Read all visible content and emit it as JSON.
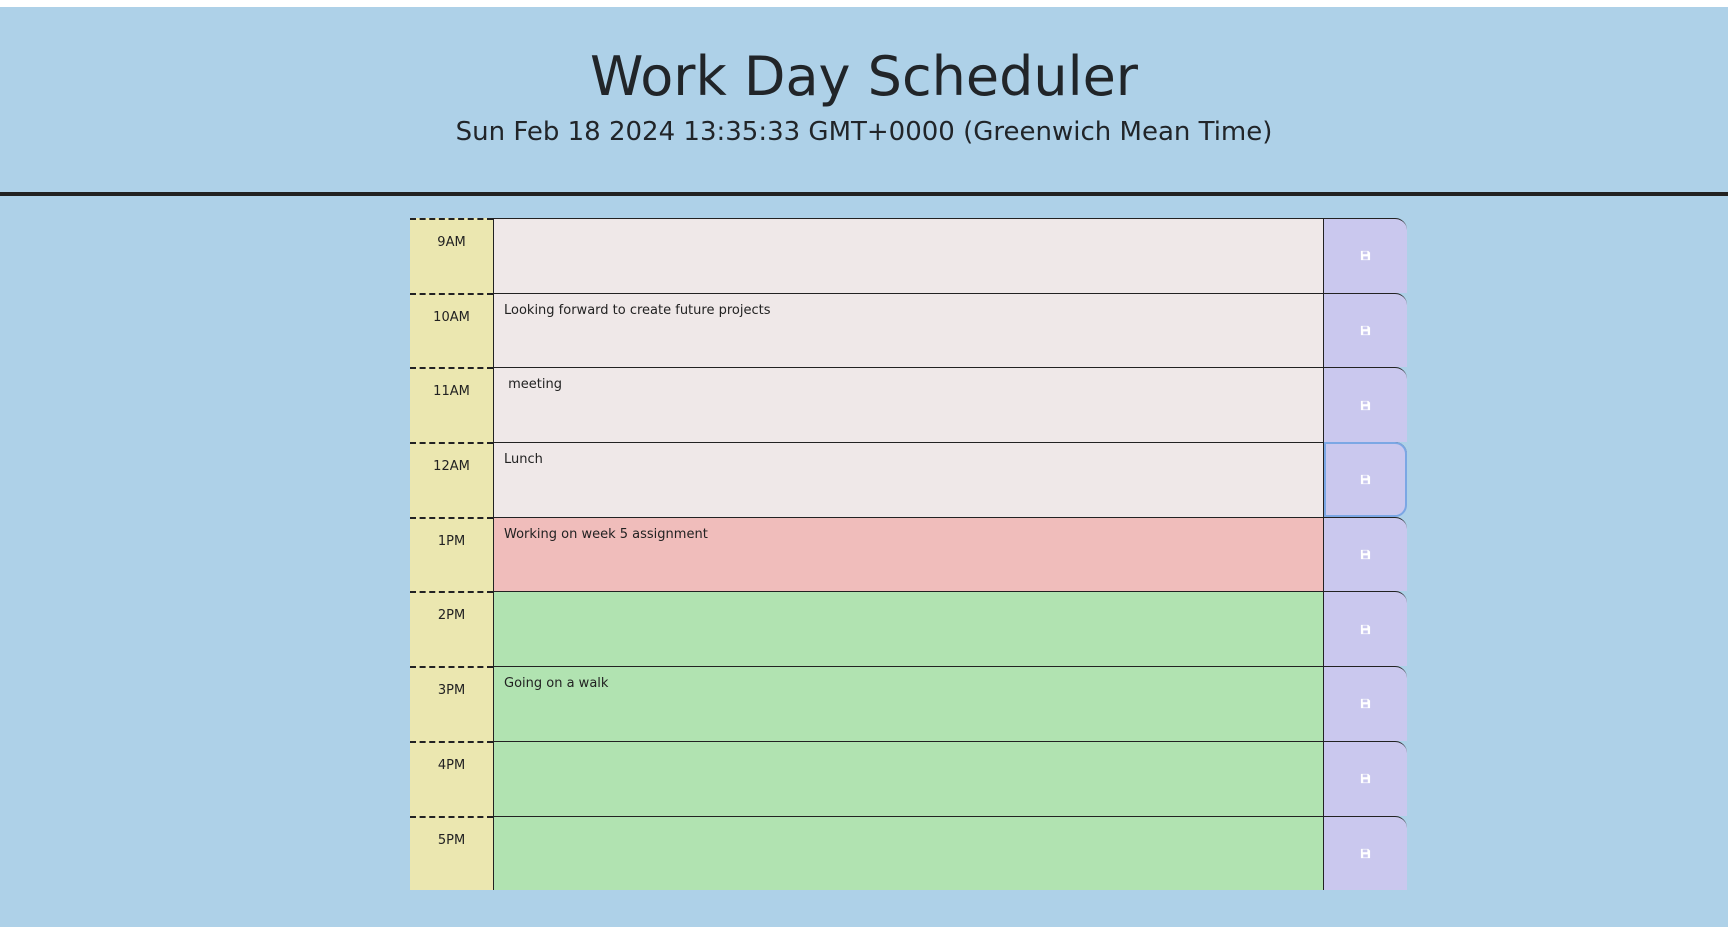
{
  "header": {
    "title": "Work Day Scheduler",
    "current_date": "Sun Feb 18 2024 13:35:33 GMT+0000 (Greenwich Mean Time)"
  },
  "colors": {
    "background": "#aed1e8",
    "hour_column": "#ebe7b0",
    "past": "#efe8e8",
    "present": "#f0bdbb",
    "future": "#b1e3b1",
    "save_button": "#cac8ee"
  },
  "time_blocks": [
    {
      "hour": "9AM",
      "text": "",
      "state": "past",
      "save_icon": "floppy-disk-icon"
    },
    {
      "hour": "10AM",
      "text": "Looking forward to create future projects",
      "state": "past",
      "save_icon": "floppy-disk-icon"
    },
    {
      "hour": "11AM",
      "text": " meeting",
      "state": "past",
      "save_icon": "floppy-disk-icon"
    },
    {
      "hour": "12AM",
      "text": "Lunch",
      "state": "past",
      "save_icon": "floppy-disk-icon"
    },
    {
      "hour": "1PM",
      "text": "Working on week 5 assignment",
      "state": "present",
      "save_icon": "floppy-disk-icon"
    },
    {
      "hour": "2PM",
      "text": "",
      "state": "future",
      "save_icon": "floppy-disk-icon"
    },
    {
      "hour": "3PM",
      "text": "Going on a walk",
      "state": "future",
      "save_icon": "floppy-disk-icon"
    },
    {
      "hour": "4PM",
      "text": "",
      "state": "future",
      "save_icon": "floppy-disk-icon"
    },
    {
      "hour": "5PM",
      "text": "",
      "state": "future",
      "save_icon": "floppy-disk-icon"
    }
  ]
}
